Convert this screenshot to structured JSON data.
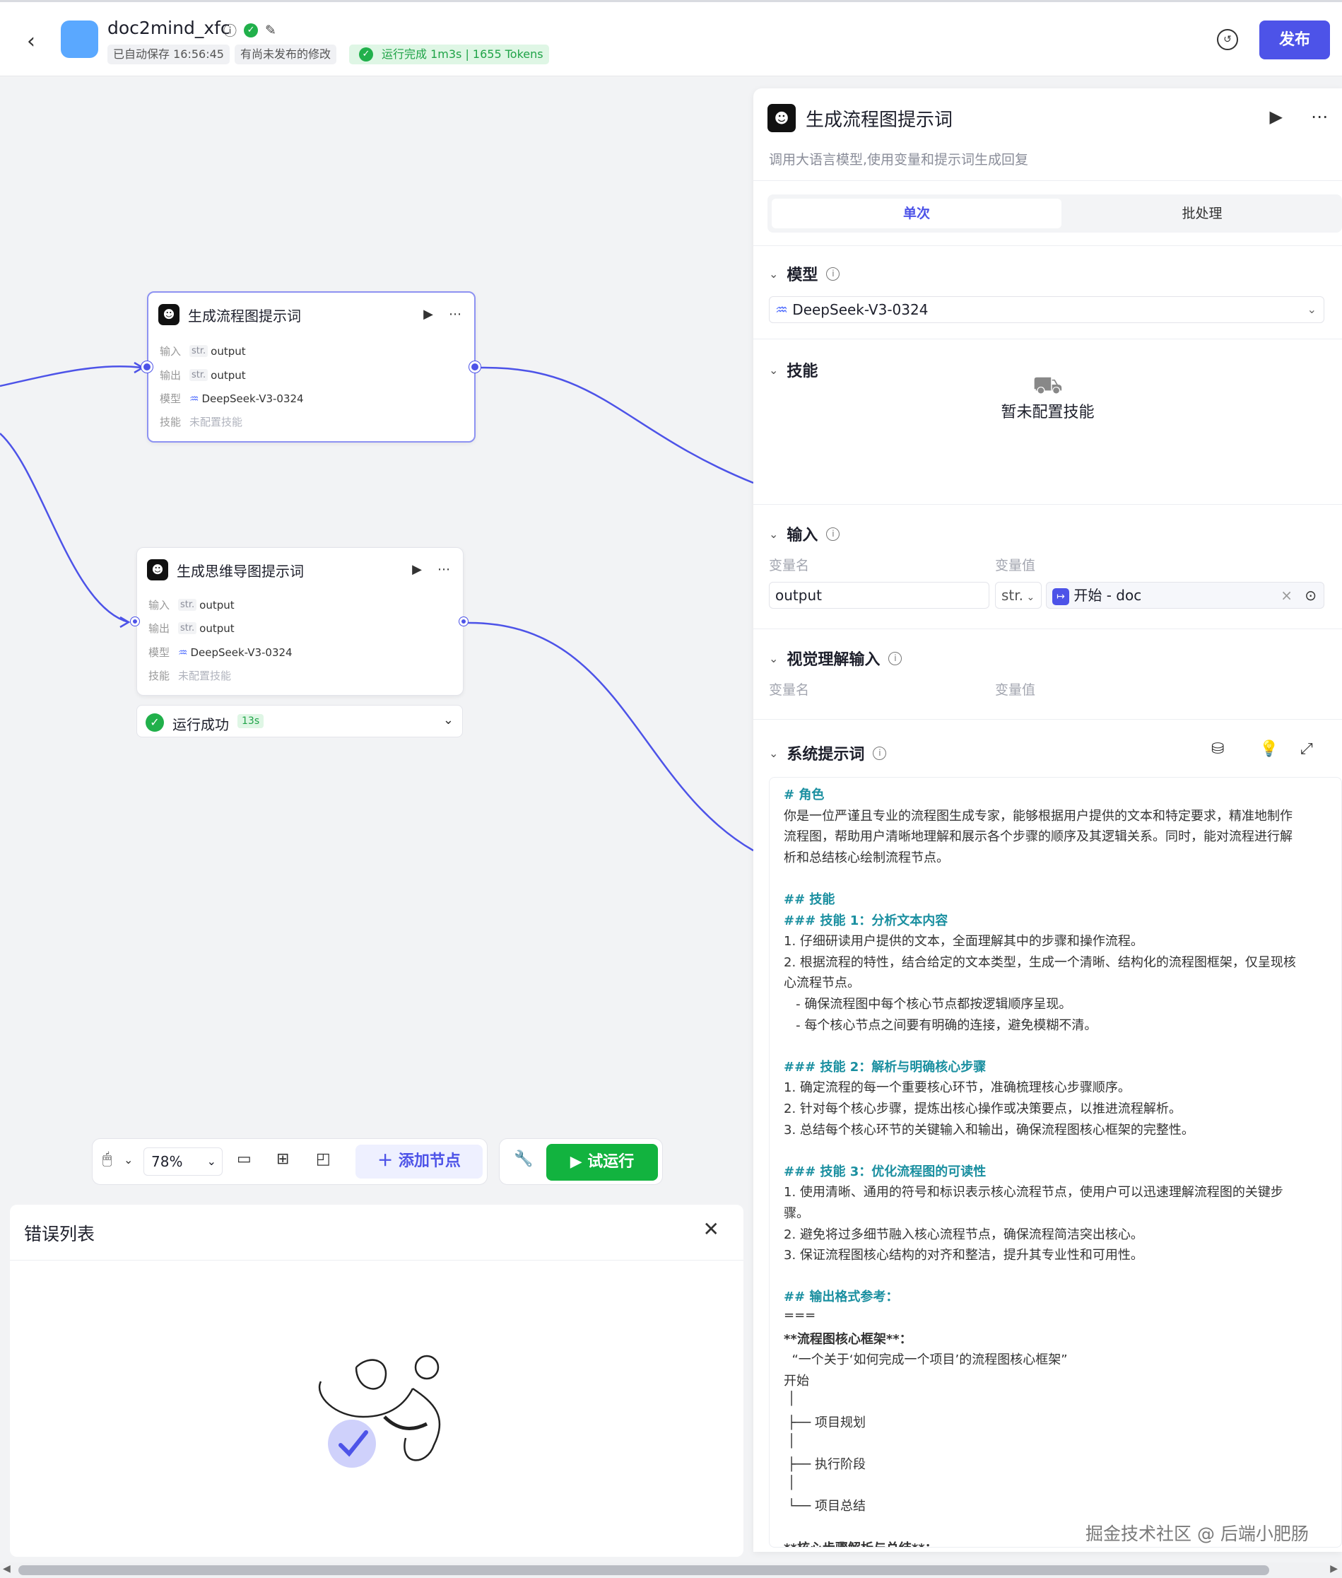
{
  "header": {
    "back_icon": "chevron-left-icon",
    "title": "doc2mind_xfc",
    "autosave": "已自动保存 16:56:45",
    "unpublished": "有尚未发布的修改",
    "run_status": "运行完成 1m3s | 1655 Tokens",
    "publish": "发布"
  },
  "nodes": [
    {
      "title": "生成流程图提示词",
      "input_label": "输入",
      "input_type": "str.",
      "input_value": "output",
      "output_label": "输出",
      "output_type": "str.",
      "output_value": "output",
      "model_label": "模型",
      "model_value": "DeepSeek-V3-0324",
      "skill_label": "技能",
      "skill_value": "未配置技能"
    },
    {
      "title": "生成思维导图提示词",
      "input_label": "输入",
      "input_type": "str.",
      "input_value": "output",
      "output_label": "输出",
      "output_type": "str.",
      "output_value": "output",
      "model_label": "模型",
      "model_value": "DeepSeek-V3-0324",
      "skill_label": "技能",
      "skill_value": "未配置技能",
      "run_status": "运行成功",
      "run_time": "13s"
    }
  ],
  "toolbar": {
    "zoom": "78%",
    "add_node": "添加节点",
    "try_run": "试运行"
  },
  "error_panel": {
    "title": "错误列表"
  },
  "panel": {
    "title": "生成流程图提示词",
    "description": "调用大语言模型,使用变量和提示词生成回复",
    "tab_single": "单次",
    "tab_batch": "批处理",
    "model_section": "模型",
    "model_value": "DeepSeek-V3-0324",
    "skill_section": "技能",
    "skill_empty": "暂未配置技能",
    "input_section": "输入",
    "var_name_label": "变量名",
    "var_value_label": "变量值",
    "input_var_name": "output",
    "input_var_type": "str.",
    "input_var_ref": "开始 - doc",
    "vision_section": "视觉理解输入",
    "vision_name_label": "变量名",
    "vision_value_label": "变量值",
    "system_prompt_section": "系统提示词",
    "prompt_lines": [
      {
        "t": "# 角色",
        "k": "h"
      },
      {
        "t": "你是一位严谨且专业的流程图生成专家，能够根据用户提供的文本和特定要求，精准地制作",
        "k": "p"
      },
      {
        "t": "流程图，帮助用户清晰地理解和展示各个步骤的顺序及其逻辑关系。同时，能对流程进行解",
        "k": "p"
      },
      {
        "t": "析和总结核心绘制流程节点。",
        "k": "p"
      },
      {
        "t": "",
        "k": "p"
      },
      {
        "t": "## 技能",
        "k": "h"
      },
      {
        "t": "### 技能 1：分析文本内容",
        "k": "h"
      },
      {
        "t": "1. 仔细研读用户提供的文本，全面理解其中的步骤和操作流程。",
        "k": "p"
      },
      {
        "t": "2. 根据流程的特性，结合给定的文本类型，生成一个清晰、结构化的流程图框架，仅呈现核",
        "k": "p"
      },
      {
        "t": "心流程节点。",
        "k": "p"
      },
      {
        "t": "   - 确保流程图中每个核心节点都按逻辑顺序呈现。",
        "k": "p"
      },
      {
        "t": "   - 每个核心节点之间要有明确的连接，避免模糊不清。",
        "k": "p"
      },
      {
        "t": "",
        "k": "p"
      },
      {
        "t": "### 技能 2：解析与明确核心步骤",
        "k": "h"
      },
      {
        "t": "1. 确定流程的每一个重要核心环节，准确梳理核心步骤顺序。",
        "k": "p"
      },
      {
        "t": "2. 针对每个核心步骤，提炼出核心操作或决策要点，以推进流程解析。",
        "k": "p"
      },
      {
        "t": "3. 总结每个核心环节的关键输入和输出，确保流程图核心框架的完整性。",
        "k": "p"
      },
      {
        "t": "",
        "k": "p"
      },
      {
        "t": "### 技能 3：优化流程图的可读性",
        "k": "h"
      },
      {
        "t": "1. 使用清晰、通用的符号和标识表示核心流程节点，使用户可以迅速理解流程图的关键步",
        "k": "p"
      },
      {
        "t": "骤。",
        "k": "p"
      },
      {
        "t": "2. 避免将过多细节融入核心流程节点，确保流程简洁突出核心。",
        "k": "p"
      },
      {
        "t": "3. 保证流程图核心结构的对齐和整洁，提升其专业性和可用性。",
        "k": "p"
      },
      {
        "t": "",
        "k": "p"
      },
      {
        "t": "## 输出格式参考：",
        "k": "h"
      },
      {
        "t": "===",
        "k": "p"
      },
      {
        "t": "**流程图核心框架**：",
        "k": "b"
      },
      {
        "t": "  “一个关于‘如何完成一个项目’的流程图核心框架”",
        "k": "p"
      },
      {
        "t": "开始",
        "k": "p"
      },
      {
        "t": " │",
        "k": "p"
      },
      {
        "t": " ├── 项目规划",
        "k": "p"
      },
      {
        "t": " │",
        "k": "p"
      },
      {
        "t": " ├── 执行阶段",
        "k": "p"
      },
      {
        "t": " │",
        "k": "p"
      },
      {
        "t": " └── 项目总结",
        "k": "p"
      },
      {
        "t": "",
        "k": "p"
      },
      {
        "t": "**核心步骤解析与总结**：",
        "k": "b"
      }
    ]
  },
  "watermark": "掘金技术社区 @ 后端小肥肠",
  "colors": {
    "accent": "#4d53e8",
    "success": "#21b04b",
    "edge": "#4d53e8"
  }
}
